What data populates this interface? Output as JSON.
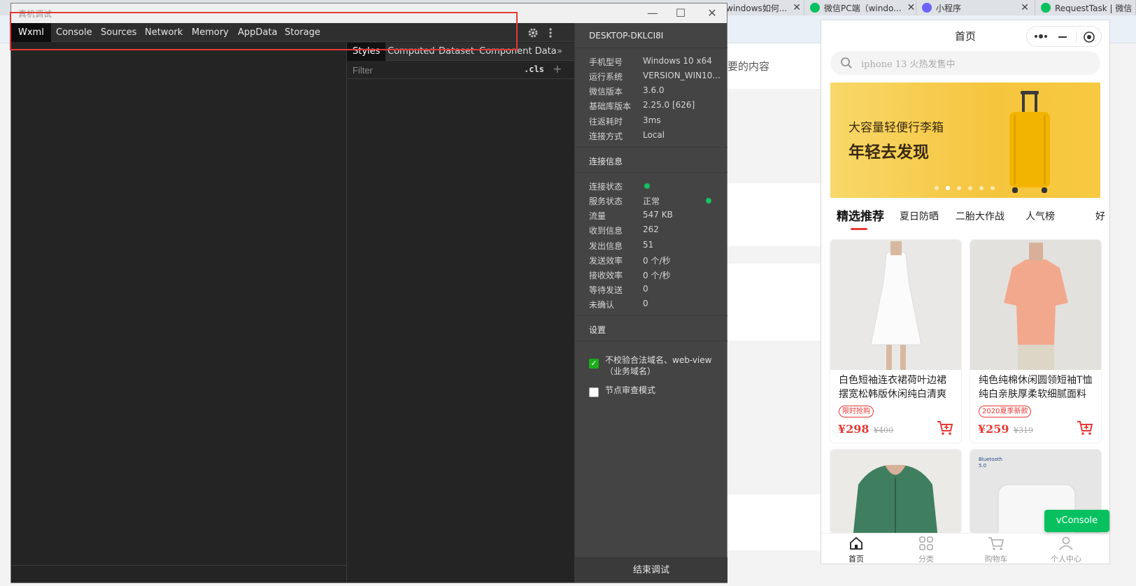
{
  "browser": {
    "tabs": [
      {
        "label": "windows如何...",
        "color": "#2f80ed"
      },
      {
        "label": "微信PC端（windo...",
        "color": "#07c160"
      },
      {
        "label": "小程序",
        "color": "#6c63ff"
      },
      {
        "label": "RequestTask | 微信",
        "color": "#07c160"
      }
    ],
    "page_hint": "要的内容"
  },
  "devtools": {
    "window_title": "真机调试",
    "tabs": [
      "Wxml",
      "Console",
      "Sources",
      "Network",
      "Memory",
      "AppData",
      "Storage"
    ],
    "active_tab": "Wxml",
    "styles_tabs": [
      "Styles",
      "Computed",
      "Dataset",
      "Component Data"
    ],
    "filter_placeholder": "Filter",
    "cls_label": ".cls",
    "plus_label": "+",
    "more_tabs": "»",
    "icons": {
      "settings": "gear-icon",
      "menu": "kebab-icon"
    }
  },
  "info": {
    "device_name": "DESKTOP-DKLCI8I",
    "device": [
      {
        "k": "手机型号",
        "v": "Windows 10 x64"
      },
      {
        "k": "运行系统",
        "v": "VERSION_WIN10..."
      },
      {
        "k": "微信版本",
        "v": "3.6.0"
      },
      {
        "k": "基础库版本",
        "v": "2.25.0 [626]"
      },
      {
        "k": "往返耗时",
        "v": "3ms"
      },
      {
        "k": "连接方式",
        "v": "Local"
      }
    ],
    "conn_title": "连接信息",
    "conn": [
      {
        "k": "连接状态",
        "v": ""
      },
      {
        "k": "服务状态",
        "v": "正常"
      },
      {
        "k": "流量",
        "v": "547 KB"
      },
      {
        "k": "收到信息",
        "v": "262"
      },
      {
        "k": "发出信息",
        "v": "51"
      },
      {
        "k": "发送效率",
        "v": "0 个/秒"
      },
      {
        "k": "接收效率",
        "v": "0 个/秒"
      },
      {
        "k": "等待发送",
        "v": "0"
      },
      {
        "k": "未确认",
        "v": "0"
      }
    ],
    "settings_title": "设置",
    "opt1": "不校验合法域名、web-view（业务域名）",
    "opt1_checked": true,
    "opt2": "节点审查模式",
    "opt2_checked": false,
    "end_button": "结束调试",
    "status_color": "#18c060"
  },
  "phone": {
    "title": "首页",
    "search_placeholder": "iphone 13 火热发售中",
    "banner_line1": "大容量轻便行李箱",
    "banner_line2": "年轻去发现",
    "banner_dots": 6,
    "banner_active_dot": 1,
    "categories": [
      "精选推荐",
      "夏日防晒",
      "二胎大作战",
      "人气榜",
      "好"
    ],
    "active_category": 0,
    "products": [
      {
        "name": "白色短袖连衣裙荷叶边裙摆宽松韩版休闲纯白清爽",
        "tag": "限时抢购",
        "price": "¥298",
        "old_price": "¥400",
        "image": "white-dress-photo"
      },
      {
        "name": "纯色纯棉休闲圆领短袖T恤纯白亲肤厚柔软细腻面料",
        "tag": "2020夏季新款",
        "price": "¥259",
        "old_price": "¥319",
        "image": "pink-tshirt-photo"
      },
      {
        "name": "",
        "tag": "",
        "price": "",
        "old_price": "",
        "image": "green-hoodie-photo"
      },
      {
        "name": "",
        "tag": "",
        "price": "",
        "old_price": "",
        "image": "white-device-photo"
      }
    ],
    "bluetooth_label": "Bluetooth\n5.0",
    "tabbar": [
      {
        "label": "首页",
        "icon": "home-icon"
      },
      {
        "label": "分类",
        "icon": "grid-icon"
      },
      {
        "label": "购物车",
        "icon": "cart-icon"
      },
      {
        "label": "个人中心",
        "icon": "user-icon"
      }
    ],
    "vconsole": "vConsole",
    "accent": "#e53935"
  }
}
